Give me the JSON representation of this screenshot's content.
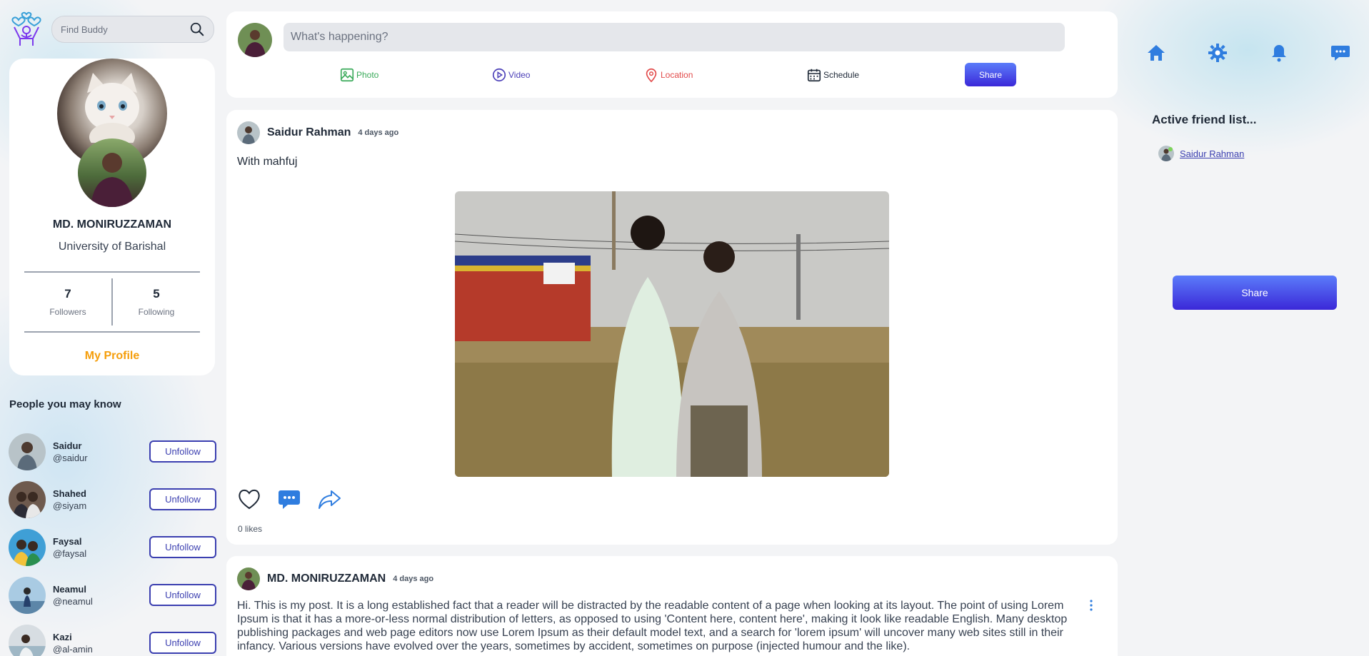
{
  "search": {
    "placeholder": "Find Buddy"
  },
  "profile": {
    "name": "MD. MONIRUZZAMAN",
    "school": "University of Barishal",
    "followers_count": "7",
    "followers_label": "Followers",
    "following_count": "5",
    "following_label": "Following",
    "my_profile_label": "My Profile"
  },
  "people_you_may_know": {
    "title": "People you may know",
    "button_label": "Unfollow",
    "items": [
      {
        "name": "Saidur",
        "handle": "@saidur"
      },
      {
        "name": "Shahed",
        "handle": "@siyam"
      },
      {
        "name": "Faysal",
        "handle": "@faysal"
      },
      {
        "name": "Neamul",
        "handle": "@neamul"
      },
      {
        "name": "Kazi",
        "handle": "@al-amin"
      }
    ]
  },
  "composer": {
    "placeholder": "What's happening?",
    "options": {
      "photo": "Photo",
      "video": "Video",
      "location": "Location",
      "schedule": "Schedule"
    },
    "share_label": "Share"
  },
  "posts": [
    {
      "author": "Saidur Rahman",
      "time": "4 days ago",
      "text": "With mahfuj",
      "likes": "0 likes"
    },
    {
      "author": "MD. MONIRUZZAMAN",
      "time": "4 days ago",
      "text": "Hi. This is my post. It is a long established fact that a reader will be distracted by the readable content of a page when looking at its layout. The point of using Lorem Ipsum is that it has a more-or-less normal distribution of letters, as opposed to using 'Content here, content here', making it look like readable English. Many desktop publishing packages and web page editors now use Lorem Ipsum as their default model text, and a search for 'lorem ipsum' will uncover many web sites still in their infancy. Various versions have evolved over the years, sometimes by accident, sometimes on purpose (injected humour and the like)."
    }
  ],
  "right_panel": {
    "active_title": "Active friend list...",
    "active_friends": [
      "Saidur Rahman"
    ],
    "share_label": "Share"
  },
  "icons": {
    "nav": [
      "home-icon",
      "settings-icon",
      "notification-icon",
      "message-icon"
    ],
    "accent": "#2f7ddf",
    "orange": "#f59e0b",
    "indigo": "#3b3fb0"
  }
}
